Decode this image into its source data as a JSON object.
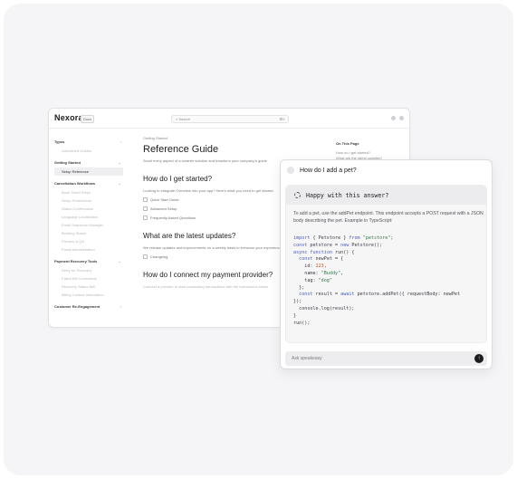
{
  "app": {
    "logo": "Nexora",
    "badge": "Docs"
  },
  "search": {
    "placeholder": "Search",
    "shortcut": "⌘K"
  },
  "sidebar": {
    "groups": [
      {
        "label": "Types",
        "items": [
          "Unleashed Guides"
        ]
      },
      {
        "label": "Getting Started",
        "items": [
          "Setup Reference"
        ]
      },
      {
        "label": "Cancellation Workflows",
        "items": [
          "Book Ticket Steps",
          "Setup Preferences",
          "Status Confirmation",
          "Language Localization",
          "Email Sequence Manager",
          "Booking Status",
          "Preview & QA",
          "Portal Administration"
        ]
      },
      {
        "label": "Payment Recovery Tools",
        "items": [
          "Retry for Recovery",
          "Failed Bill Corrections",
          "Recovery Status Bell",
          "Billing Contact Information"
        ]
      },
      {
        "label": "Customer Re-Engagement",
        "items": []
      }
    ],
    "active_item": "Setup Reference"
  },
  "main": {
    "breadcrumb": "Getting Started",
    "title": "Reference Guide",
    "lead": "Scroll every aspect of a smarter solution and transform your company's guide",
    "h2_start": "How do I get started?",
    "p_start": "Looking to integrate Overview into your app? Here's what you need to get started.",
    "links": [
      "Quick Start Guide",
      "Advanced Setup",
      "Frequently Asked Questions"
    ],
    "h2_updates": "What are the latest updates?",
    "p_updates": "We release updates and improvements on a weekly basis to enhance your experience.",
    "updates_link": "Changelog",
    "h2_payment": "How do I connect my payment provider?",
    "p_payment": "Connect a provider to start processing transactions with the instructions below"
  },
  "toc": {
    "title": "On This Page",
    "items": [
      "How do I get started?",
      "What are the latest updates?"
    ]
  },
  "chat": {
    "question": "How do I add a pet?",
    "status": "Happy with this answer?",
    "answer": "To add a pet, use the addPet endpoint. This endpoint accepts a POST request with a JSON body describing the pet. Example in TypeScript:",
    "code": [
      "import { Petstore } from \"petstore\";",
      "const petstore = new Petstore();",
      "async function run() {",
      "  const newPet = {",
      "    id: 123,",
      "    name: \"Buddy\",",
      "    tag: \"dog\"",
      "  };",
      "  const result = await petstore.addPet({ requestBody: newPet",
      "});",
      "  console.log(result);",
      "}",
      "run();"
    ],
    "input_placeholder": "Ask speakeasy"
  },
  "colors": {
    "accent": "#4a5ab8",
    "string": "#2f7a4a",
    "number": "#b8561b"
  }
}
